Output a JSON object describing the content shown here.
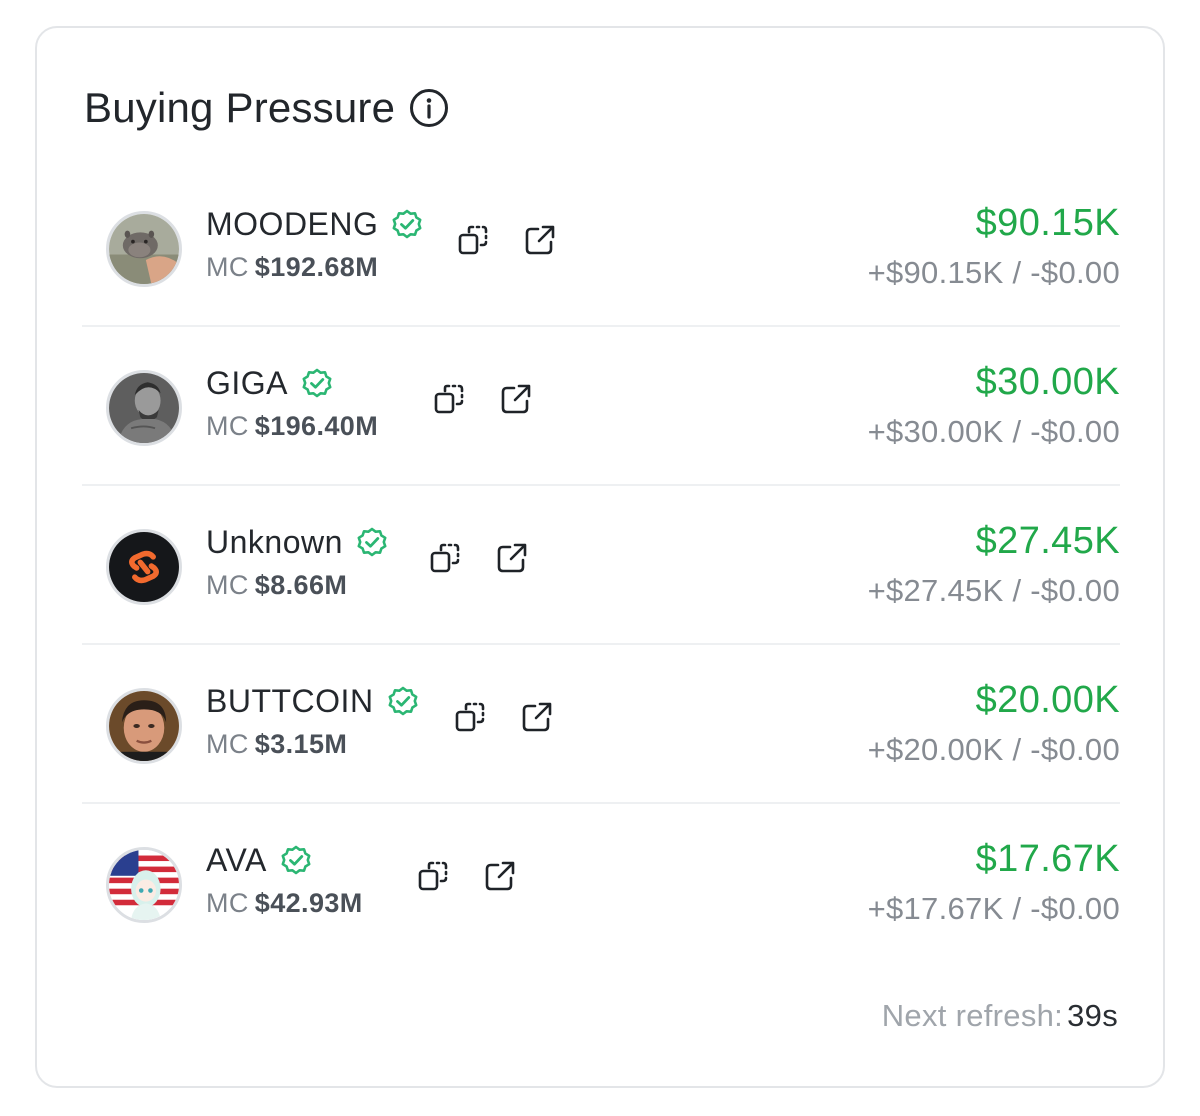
{
  "widget": {
    "title": "Buying Pressure",
    "info_icon": "info-circle-icon",
    "refresh_label": "Next refresh:",
    "refresh_value": "39s"
  },
  "tokens": [
    {
      "name": "MOODENG",
      "mc_label": "MC",
      "market_cap": "$192.68M",
      "net": "$90.15K",
      "breakdown": "+$90.15K / -$0.00",
      "avatar": "pygmy-hippo-avatar"
    },
    {
      "name": "GIGA",
      "mc_label": "MC",
      "market_cap": "$196.40M",
      "net": "$30.00K",
      "breakdown": "+$30.00K / -$0.00",
      "avatar": "gigachad-avatar"
    },
    {
      "name": "Unknown",
      "mc_label": "MC",
      "market_cap": "$8.66M",
      "net": "$27.45K",
      "breakdown": "+$27.45K / -$0.00",
      "avatar": "orange-s-logo-avatar"
    },
    {
      "name": "BUTTCOIN",
      "mc_label": "MC",
      "market_cap": "$3.15M",
      "net": "$20.00K",
      "breakdown": "+$20.00K / -$0.00",
      "avatar": "man-portrait-avatar"
    },
    {
      "name": "AVA",
      "mc_label": "MC",
      "market_cap": "$42.93M",
      "net": "$17.67K",
      "breakdown": "+$17.67K / -$0.00",
      "avatar": "anime-girl-flag-avatar"
    }
  ],
  "icons": {
    "verified": "verified-badge-icon",
    "copy": "copy-icon",
    "open": "external-link-icon"
  },
  "colors": {
    "positive": "#21a84a",
    "verified": "#2bb673",
    "muted": "#868b92",
    "border": "#e3e5e8"
  }
}
